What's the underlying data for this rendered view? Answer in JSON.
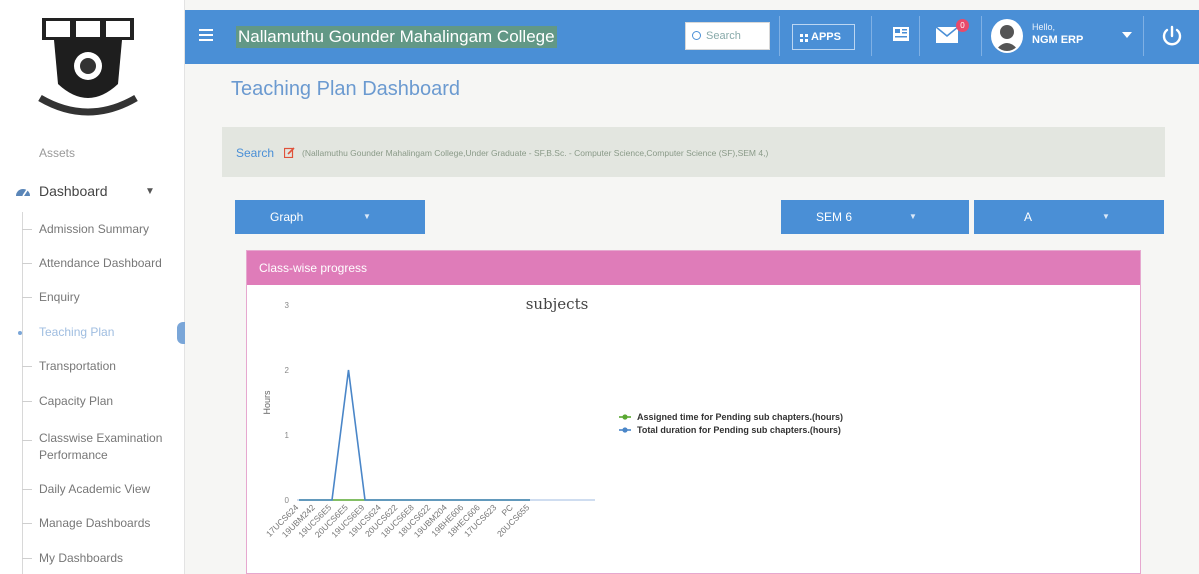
{
  "sidebar": {
    "partial_top_item": "Assets",
    "dashboard_label": "Dashboard",
    "items": [
      {
        "label": "Admission Summary"
      },
      {
        "label": "Attendance Dashboard"
      },
      {
        "label": "Enquiry"
      },
      {
        "label": "Teaching Plan",
        "active": true
      },
      {
        "label": "Transportation"
      },
      {
        "label": "Capacity Plan"
      },
      {
        "label": "Classwise Examination Performance"
      },
      {
        "label": "Daily Academic View"
      },
      {
        "label": "Manage Dashboards"
      },
      {
        "label": "My Dashboards"
      }
    ]
  },
  "topbar": {
    "college_name": "Nallamuthu Gounder Mahalingam College",
    "search_placeholder": "Search",
    "apps_label": "APPS",
    "mail_badge": "0",
    "greeting": "Hello,",
    "user_name": "NGM ERP",
    "accent": "#4a8fd6"
  },
  "page": {
    "title": "Teaching Plan Dashboard",
    "search_label": "Search",
    "search_path": "(Nallamuthu Gounder Mahalingam College,Under Graduate - SF,B.Sc. - Computer Science,Computer Science (SF),SEM 4,)",
    "view_select": "Graph",
    "sem_select": "SEM 6",
    "section_select": "A",
    "panel_title": "Class-wise progress",
    "panel_color": "#df7cb9"
  },
  "chart_data": {
    "type": "line",
    "title": "subjects",
    "ylabel": "Hours",
    "xlabel": "",
    "ylim": [
      0,
      3
    ],
    "yticks": [
      0,
      1,
      2,
      3
    ],
    "categories": [
      "17UCS624",
      "19UBM242",
      "19UCS6E5",
      "20UCS6E5",
      "19UCS6E9",
      "19UCS624",
      "20UCS622",
      "18UCS6E8",
      "18UCS622",
      "19UBM204",
      "19BHE606",
      "18HEC606",
      "17UCS623",
      "PC",
      "20UCS655"
    ],
    "series": [
      {
        "name": "Assigned time for Pending sub chapters.(hours)",
        "color": "#5aa832",
        "values": [
          0,
          0,
          0,
          0,
          0,
          0,
          0,
          0,
          0,
          0,
          0,
          0,
          0,
          0,
          0
        ]
      },
      {
        "name": "Total duration for Pending sub chapters.(hours)",
        "color": "#4a86c8",
        "values": [
          0,
          0,
          0,
          2,
          0,
          0,
          0,
          0,
          0,
          0,
          0,
          0,
          0,
          0,
          0
        ]
      }
    ],
    "legend": "right"
  }
}
